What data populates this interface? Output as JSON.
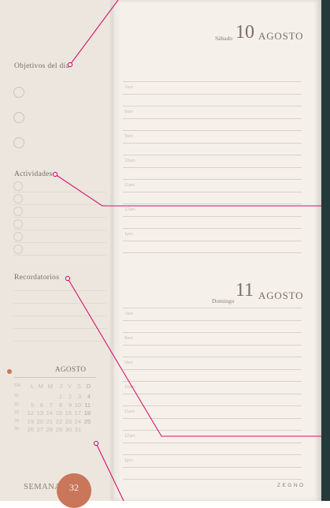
{
  "sidebar": {
    "objetivos_title": "Objetivos del día",
    "actividades_title": "Actividades",
    "recordatorios_title": "Recordatorios"
  },
  "calendar": {
    "month": "AGOSTO",
    "header": {
      "week": "SM",
      "days": [
        "L",
        "M",
        "M",
        "J",
        "V",
        "S",
        "D"
      ]
    },
    "weeks": [
      {
        "wk": "31",
        "days": [
          "",
          "",
          "",
          "1",
          "2",
          "3",
          "4"
        ]
      },
      {
        "wk": "32",
        "days": [
          "5",
          "6",
          "7",
          "8",
          "9",
          "10",
          "11"
        ]
      },
      {
        "wk": "33",
        "days": [
          "12",
          "13",
          "14",
          "15",
          "16",
          "17",
          "18"
        ]
      },
      {
        "wk": "34",
        "days": [
          "19",
          "20",
          "21",
          "22",
          "23",
          "24",
          "25"
        ]
      },
      {
        "wk": "35",
        "days": [
          "26",
          "27",
          "28",
          "29",
          "30",
          "31",
          ""
        ]
      }
    ]
  },
  "footer": {
    "semana_label": "SEMANA",
    "week_number": "32",
    "brand": "ZEGNO"
  },
  "days": [
    {
      "day_name": "Sábado",
      "day_number": "10",
      "month": "AGOSTO",
      "hours": [
        "7am",
        "8am",
        "9am",
        "10am",
        "11am",
        "12am",
        "1pm"
      ]
    },
    {
      "day_name": "Domingo",
      "day_number": "11",
      "month": "AGOSTO",
      "hours": [
        "7am",
        "8am",
        "9am",
        "10am",
        "11am",
        "12am",
        "1pm"
      ]
    }
  ],
  "colors": {
    "accent": "#c9765a",
    "leader_line": "#d4146e",
    "cover": "#243a3a",
    "paper": "#f5f1ea"
  }
}
